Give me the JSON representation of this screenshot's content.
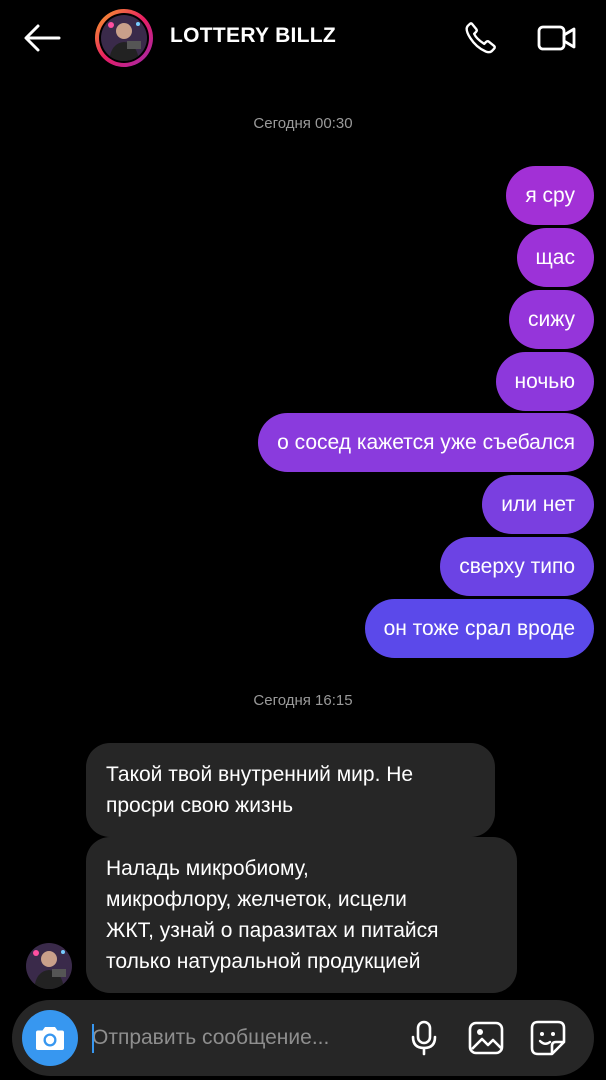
{
  "header": {
    "title": "LOTTERY BILLZ",
    "icons": [
      "back-arrow-icon",
      "avatar",
      "phone-icon",
      "video-camera-icon"
    ]
  },
  "timestamps": [
    "Сегодня 00:30",
    "Сегодня 16:15"
  ],
  "sent_messages": [
    "я сру",
    "щас",
    "сижу",
    "ночью",
    "о сосед кажется уже съебался",
    "или нет",
    "сверху типо",
    "он тоже срал вроде"
  ],
  "received_messages": [
    [
      "Такой твой внутренний мир. Не",
      "просри свою жизнь"
    ],
    [
      "Наладь микробиому,",
      "микрофлору, желчеток, исцели",
      "ЖКТ, узнай о паразитах и питайся",
      "только натуральной продукцией"
    ]
  ],
  "composer": {
    "placeholder": "Отправить сообщение...",
    "icons": [
      "camera-icon",
      "microphone-icon",
      "gallery-icon",
      "sticker-icon"
    ]
  },
  "colors": {
    "background": "#000000",
    "received_bubble": "#262626",
    "sent_gradient_top": "#a230d6",
    "sent_gradient_bottom": "#5b49ea",
    "camera_button": "#3797f0"
  }
}
